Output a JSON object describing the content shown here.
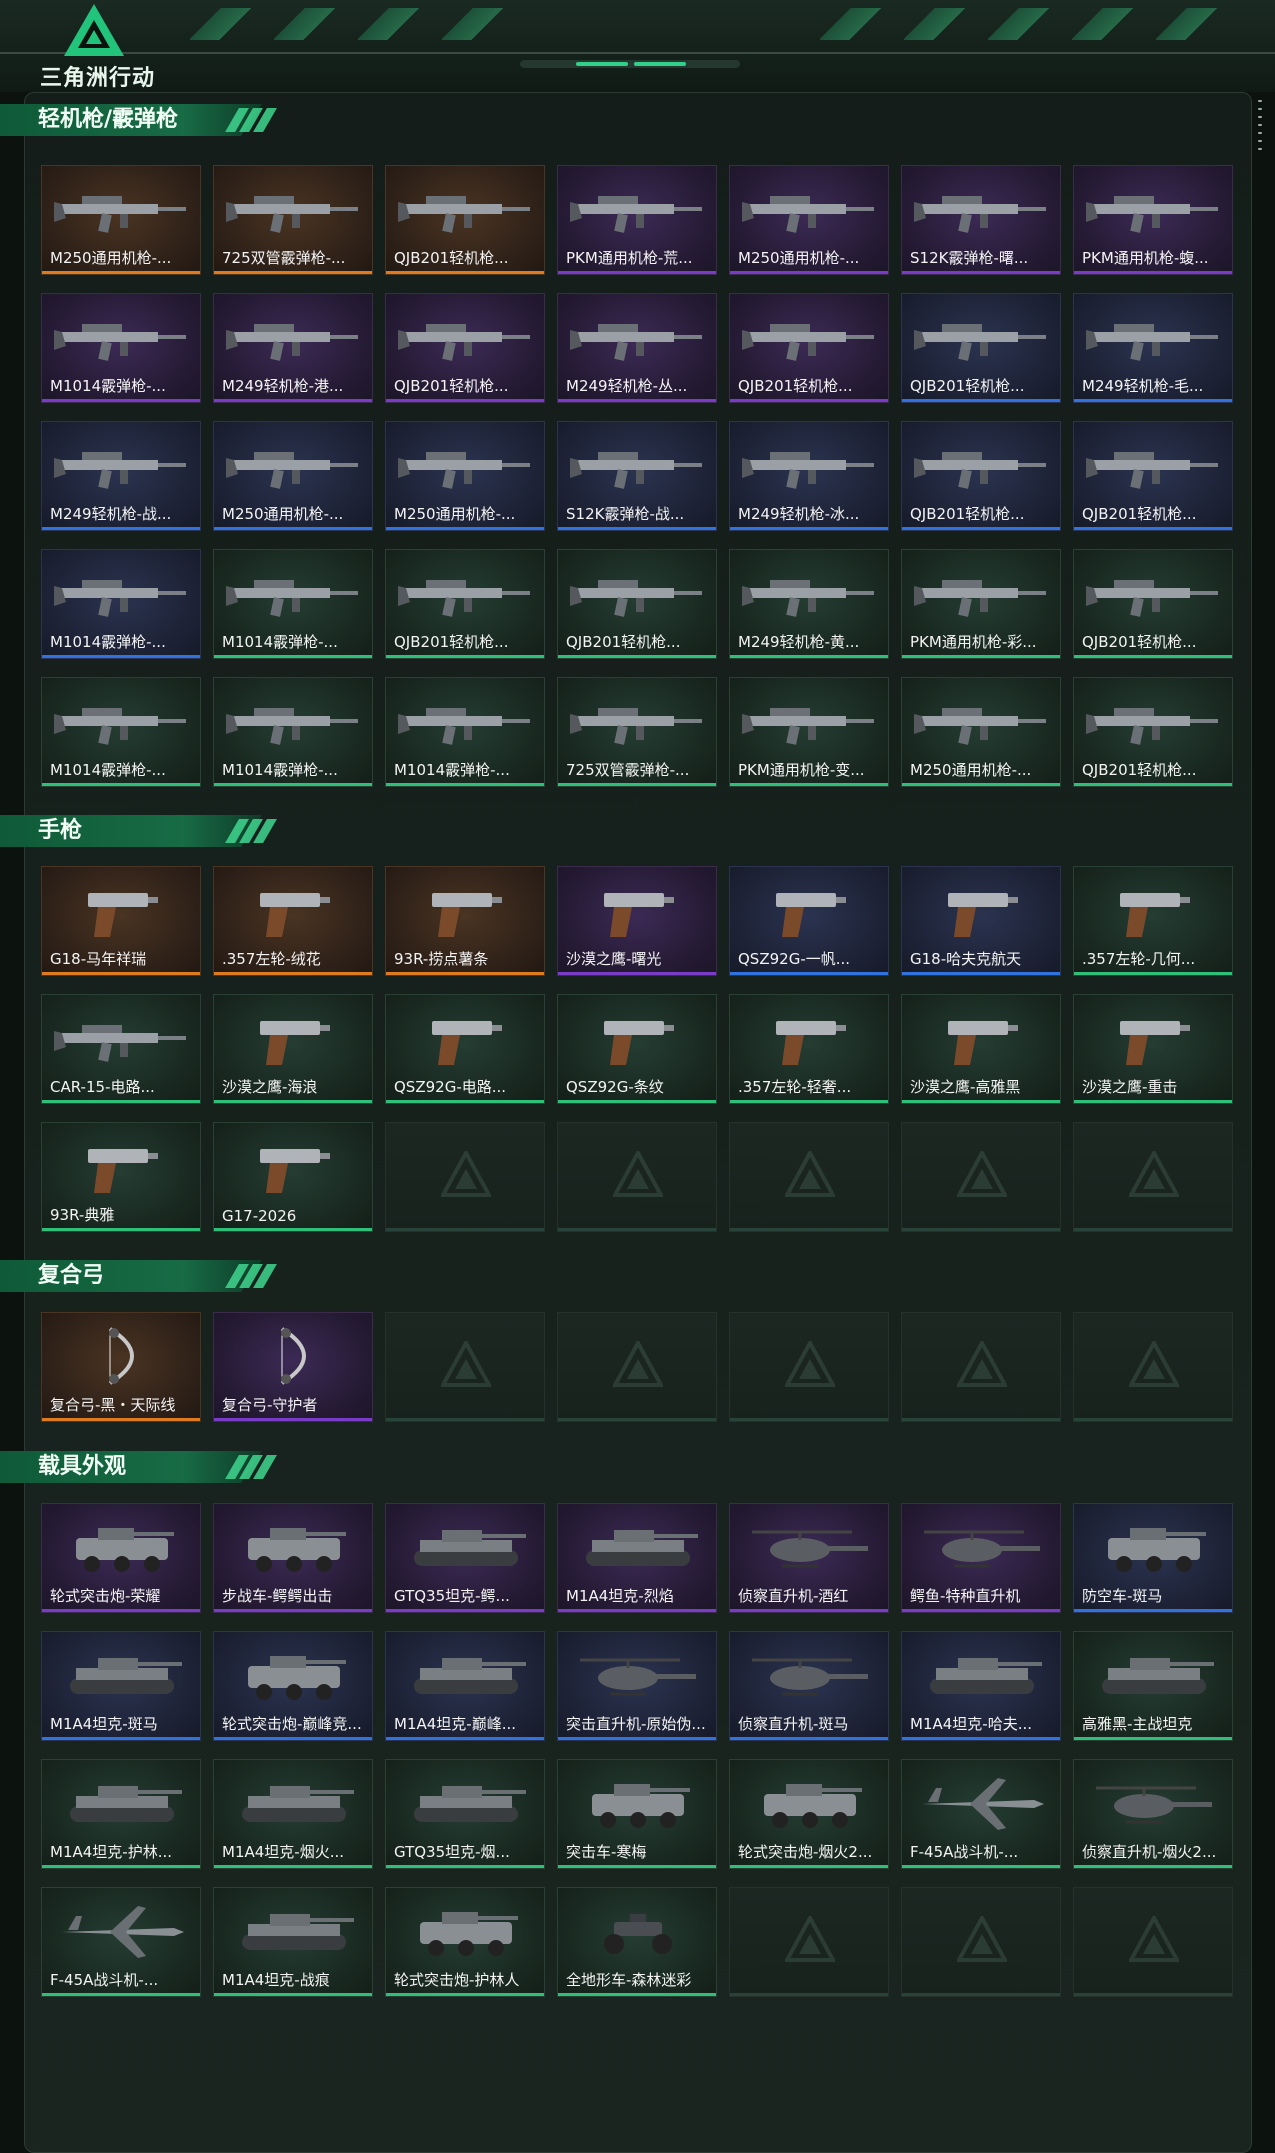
{
  "app": {
    "logo_text": "三角洲行动"
  },
  "sections": [
    {
      "title": "轻机枪/霰弹枪",
      "items": [
        {
          "name": "M250通用机枪-...",
          "rarity": "orange",
          "icon": "gun-icon"
        },
        {
          "name": "725双管霰弹枪-...",
          "rarity": "orange",
          "icon": "gun-icon"
        },
        {
          "name": "QJB201轻机枪...",
          "rarity": "orange",
          "icon": "gun-icon"
        },
        {
          "name": "PKM通用机枪-荒...",
          "rarity": "purple",
          "icon": "gun-icon"
        },
        {
          "name": "M250通用机枪-...",
          "rarity": "purple",
          "icon": "gun-icon"
        },
        {
          "name": "S12K霰弹枪-曙...",
          "rarity": "purple",
          "icon": "gun-icon"
        },
        {
          "name": "PKM通用机枪-蝮...",
          "rarity": "purple",
          "icon": "gun-icon"
        },
        {
          "name": "M1014霰弹枪-...",
          "rarity": "purple",
          "icon": "gun-icon"
        },
        {
          "name": "M249轻机枪-港...",
          "rarity": "purple",
          "icon": "gun-icon"
        },
        {
          "name": "QJB201轻机枪...",
          "rarity": "purple",
          "icon": "gun-icon"
        },
        {
          "name": "M249轻机枪-丛...",
          "rarity": "purple",
          "icon": "gun-icon"
        },
        {
          "name": "QJB201轻机枪...",
          "rarity": "purple",
          "icon": "gun-icon"
        },
        {
          "name": "QJB201轻机枪...",
          "rarity": "blue",
          "icon": "gun-icon"
        },
        {
          "name": "M249轻机枪-毛...",
          "rarity": "blue",
          "icon": "gun-icon"
        },
        {
          "name": "M249轻机枪-战...",
          "rarity": "blue",
          "icon": "gun-icon"
        },
        {
          "name": "M250通用机枪-...",
          "rarity": "blue",
          "icon": "gun-icon"
        },
        {
          "name": "M250通用机枪-...",
          "rarity": "blue",
          "icon": "gun-icon"
        },
        {
          "name": "S12K霰弹枪-战...",
          "rarity": "blue",
          "icon": "gun-icon"
        },
        {
          "name": "M249轻机枪-冰...",
          "rarity": "blue",
          "icon": "gun-icon"
        },
        {
          "name": "QJB201轻机枪...",
          "rarity": "blue",
          "icon": "gun-icon"
        },
        {
          "name": "QJB201轻机枪...",
          "rarity": "blue",
          "icon": "gun-icon"
        },
        {
          "name": "M1014霰弹枪-...",
          "rarity": "blue",
          "icon": "gun-icon"
        },
        {
          "name": "M1014霰弹枪-...",
          "rarity": "green",
          "icon": "gun-icon"
        },
        {
          "name": "QJB201轻机枪...",
          "rarity": "green",
          "icon": "gun-icon"
        },
        {
          "name": "QJB201轻机枪...",
          "rarity": "green",
          "icon": "gun-icon"
        },
        {
          "name": "M249轻机枪-黄...",
          "rarity": "green",
          "icon": "gun-icon"
        },
        {
          "name": "PKM通用机枪-彩...",
          "rarity": "green",
          "icon": "gun-icon"
        },
        {
          "name": "QJB201轻机枪...",
          "rarity": "green",
          "icon": "gun-icon"
        },
        {
          "name": "M1014霰弹枪-...",
          "rarity": "green",
          "icon": "gun-icon"
        },
        {
          "name": "M1014霰弹枪-...",
          "rarity": "green",
          "icon": "gun-icon"
        },
        {
          "name": "M1014霰弹枪-...",
          "rarity": "green",
          "icon": "gun-icon"
        },
        {
          "name": "725双管霰弹枪-...",
          "rarity": "green",
          "icon": "gun-icon"
        },
        {
          "name": "PKM通用机枪-变...",
          "rarity": "green",
          "icon": "gun-icon"
        },
        {
          "name": "M250通用机枪-...",
          "rarity": "green",
          "icon": "gun-icon"
        },
        {
          "name": "QJB201轻机枪...",
          "rarity": "green",
          "icon": "gun-icon"
        }
      ],
      "empty_slots": 0
    },
    {
      "title": "手枪",
      "items": [
        {
          "name": "G18-马年祥瑞",
          "rarity": "orange",
          "icon": "pistol-icon"
        },
        {
          "name": ".357左轮-绒花",
          "rarity": "orange",
          "icon": "pistol-icon"
        },
        {
          "name": "93R-捞点薯条",
          "rarity": "orange",
          "icon": "pistol-icon"
        },
        {
          "name": "沙漠之鹰-曙光",
          "rarity": "purple",
          "icon": "pistol-icon"
        },
        {
          "name": "QSZ92G-一帆...",
          "rarity": "blue",
          "icon": "pistol-icon"
        },
        {
          "name": "G18-哈夫克航天",
          "rarity": "blue",
          "icon": "pistol-icon"
        },
        {
          "name": ".357左轮-几何...",
          "rarity": "green",
          "icon": "pistol-icon"
        },
        {
          "name": "CAR-15-电路...",
          "rarity": "green",
          "icon": "gun-icon"
        },
        {
          "name": "沙漠之鹰-海浪",
          "rarity": "green",
          "icon": "pistol-icon"
        },
        {
          "name": "QSZ92G-电路...",
          "rarity": "green",
          "icon": "pistol-icon"
        },
        {
          "name": "QSZ92G-条纹",
          "rarity": "green",
          "icon": "pistol-icon"
        },
        {
          "name": ".357左轮-轻奢...",
          "rarity": "green",
          "icon": "pistol-icon"
        },
        {
          "name": "沙漠之鹰-高雅黑",
          "rarity": "green",
          "icon": "pistol-icon"
        },
        {
          "name": "沙漠之鹰-重击",
          "rarity": "green",
          "icon": "pistol-icon"
        },
        {
          "name": "93R-典雅",
          "rarity": "green",
          "icon": "pistol-icon"
        },
        {
          "name": "G17-2026",
          "rarity": "green",
          "icon": "pistol-icon"
        }
      ],
      "empty_slots": 5
    },
    {
      "title": "复合弓",
      "items": [
        {
          "name": "复合弓-黑・天际线",
          "rarity": "orange",
          "icon": "bow-icon"
        },
        {
          "name": "复合弓-守护者",
          "rarity": "purple",
          "icon": "bow-icon"
        }
      ],
      "empty_slots": 5
    },
    {
      "title": "载具外观",
      "items": [
        {
          "name": "轮式突击炮-荣耀",
          "rarity": "purple",
          "icon": "vehicle-icon"
        },
        {
          "name": "步战车-鳄鳄出击",
          "rarity": "purple",
          "icon": "vehicle-icon"
        },
        {
          "name": "GTQ35坦克-鳄...",
          "rarity": "purple",
          "icon": "tank-icon"
        },
        {
          "name": "M1A4坦克-烈焰",
          "rarity": "purple",
          "icon": "tank-icon"
        },
        {
          "name": "侦察直升机-酒红",
          "rarity": "purple",
          "icon": "helicopter-icon"
        },
        {
          "name": "鳄鱼-特种直升机",
          "rarity": "purple",
          "icon": "helicopter-icon"
        },
        {
          "name": "防空车-斑马",
          "rarity": "blue",
          "icon": "vehicle-icon"
        },
        {
          "name": "M1A4坦克-斑马",
          "rarity": "blue",
          "icon": "tank-icon"
        },
        {
          "name": "轮式突击炮-巅峰竞...",
          "rarity": "blue",
          "icon": "vehicle-icon"
        },
        {
          "name": "M1A4坦克-巅峰...",
          "rarity": "blue",
          "icon": "tank-icon"
        },
        {
          "name": "突击直升机-原始伪...",
          "rarity": "blue",
          "icon": "helicopter-icon"
        },
        {
          "name": "侦察直升机-斑马",
          "rarity": "blue",
          "icon": "helicopter-icon"
        },
        {
          "name": "M1A4坦克-哈夫...",
          "rarity": "blue",
          "icon": "tank-icon"
        },
        {
          "name": "高雅黑-主战坦克",
          "rarity": "green",
          "icon": "tank-icon"
        },
        {
          "name": "M1A4坦克-护林...",
          "rarity": "green",
          "icon": "tank-icon"
        },
        {
          "name": "M1A4坦克-烟火...",
          "rarity": "green",
          "icon": "tank-icon"
        },
        {
          "name": "GTQ35坦克-烟...",
          "rarity": "green",
          "icon": "tank-icon"
        },
        {
          "name": "突击车-寒梅",
          "rarity": "green",
          "icon": "vehicle-icon"
        },
        {
          "name": "轮式突击炮-烟火2...",
          "rarity": "green",
          "icon": "vehicle-icon"
        },
        {
          "name": "F-45A战斗机-...",
          "rarity": "green",
          "icon": "jet-icon"
        },
        {
          "name": "侦察直升机-烟火2...",
          "rarity": "green",
          "icon": "helicopter-icon"
        },
        {
          "name": "F-45A战斗机-...",
          "rarity": "green",
          "icon": "jet-icon"
        },
        {
          "name": "M1A4坦克-战痕",
          "rarity": "green",
          "icon": "tank-icon"
        },
        {
          "name": "轮式突击炮-护林人",
          "rarity": "green",
          "icon": "vehicle-icon"
        },
        {
          "name": "全地形车-森林迷彩",
          "rarity": "green",
          "icon": "atv-icon"
        }
      ],
      "empty_slots": 3
    }
  ]
}
